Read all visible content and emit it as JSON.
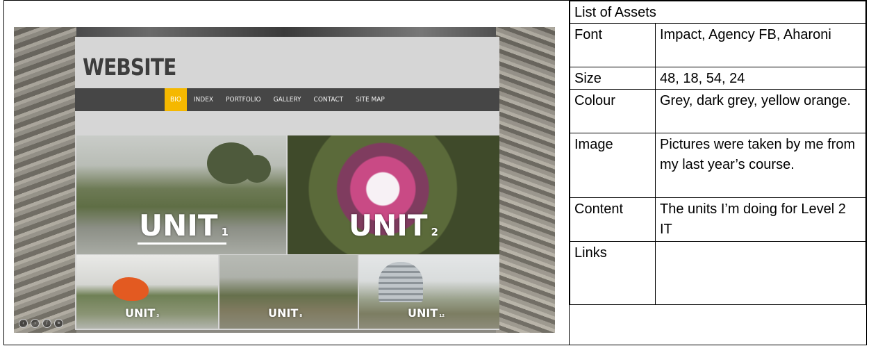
{
  "screenshot": {
    "site_title": "WEBSITE",
    "menu": [
      "BIO",
      "INDEX",
      "PORTFOLIO",
      "GALLERY",
      "CONTACT",
      "SITE MAP"
    ],
    "active_menu": "BIO",
    "accent_color": "#f5b800",
    "tiles": [
      {
        "word": "UNIT",
        "num": "1"
      },
      {
        "word": "UNIT",
        "num": "2"
      },
      {
        "word": "UNIT",
        "num": "3"
      },
      {
        "word": "UNIT",
        "num": "8"
      },
      {
        "word": "UNIT",
        "num": "12"
      }
    ]
  },
  "assets": {
    "header": "List of Assets",
    "rows": [
      {
        "key": "Font",
        "value": "Impact, Agency FB, Aharoni"
      },
      {
        "key": "Size",
        "value": "48, 18, 54, 24"
      },
      {
        "key": "Colour",
        "value": "Grey, dark grey, yellow orange."
      },
      {
        "key": "Image",
        "value": "Pictures were taken by me from my last year’s course."
      },
      {
        "key": "Content",
        "value": "The units I’m doing for Level 2 IT"
      },
      {
        "key": "Links",
        "value": ""
      }
    ]
  }
}
